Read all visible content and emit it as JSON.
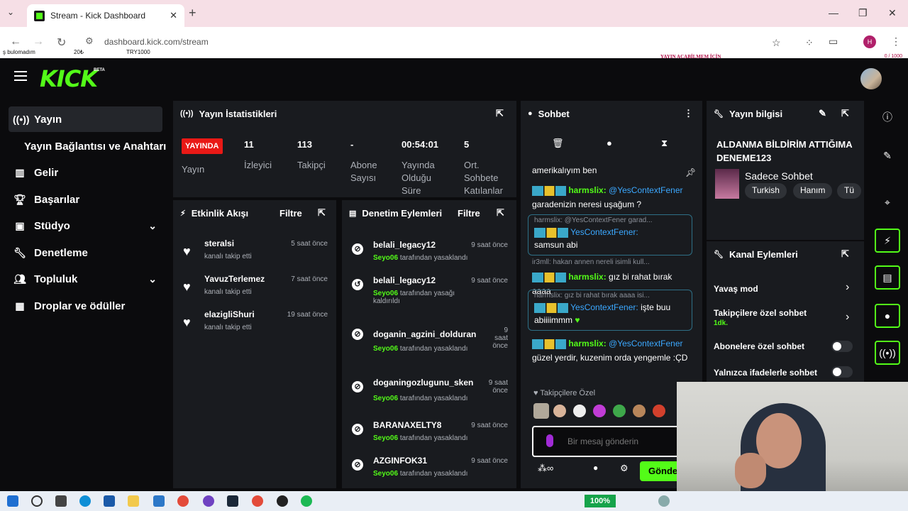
{
  "browser": {
    "tab_title": "Stream - Kick Dashboard",
    "url": "dashboard.kick.com/stream",
    "overlay_left": [
      "ş bulomadım",
      "20₺",
      "TRY1000"
    ],
    "overlay_right_title": "YAYIN AÇABİLMEM İÇİN",
    "overlay_right_count": "0 / 1000"
  },
  "header": {
    "logo": "KICK",
    "beta": "BETA"
  },
  "sidebar": {
    "items": [
      {
        "label": "Yayın",
        "icon": "broadcast-icon"
      },
      {
        "label": "Yayın Bağlantısı ve Anahtarı",
        "icon": ""
      },
      {
        "label": "Gelir",
        "icon": "bar-chart-icon"
      },
      {
        "label": "Başarılar",
        "icon": "trophy-icon"
      },
      {
        "label": "Stüdyo",
        "icon": "studio-icon"
      },
      {
        "label": "Denetleme",
        "icon": "wrench-icon"
      },
      {
        "label": "Topluluk",
        "icon": "users-icon"
      },
      {
        "label": "Droplar ve ödüller",
        "icon": "gift-icon"
      }
    ]
  },
  "stats": {
    "title": "Yayın İstatistikleri",
    "live_badge": "YAYINDA",
    "label_stream": "Yayın",
    "values": [
      "11",
      "113",
      "-",
      "00:54:01",
      "5"
    ],
    "labels": [
      "İzleyici",
      "Takipçi",
      "Abone\nSayısı",
      "Yayında\nOlduğu\nSüre",
      "Ort.\nSohbete\nKatılanlar"
    ]
  },
  "activity": {
    "title": "Etkinlik Akışı",
    "filter": "Filtre",
    "items": [
      {
        "name": "steralsi",
        "sub": "kanalı takip etti",
        "time": "5 saat önce"
      },
      {
        "name": "YavuzTerlemez",
        "sub": "kanalı takip etti",
        "time": "7 saat önce"
      },
      {
        "name": "elazigliShuri",
        "sub": "kanalı takip etti",
        "time": "19 saat önce"
      }
    ]
  },
  "moderation": {
    "title": "Denetim Eylemleri",
    "filter": "Filtre",
    "items": [
      {
        "name": "belali_legacy12",
        "mod": "Seyo06",
        "sub": "tarafından yasaklandı",
        "time": "9 saat önce"
      },
      {
        "name": "belali_legacy12",
        "mod": "Seyo06",
        "sub": "tarafından yasağı kaldırıldı",
        "time": "9 saat önce"
      },
      {
        "name": "doganin_agzini_dolduran",
        "mod": "Seyo06",
        "sub": "tarafından yasaklandı",
        "time": "9 saat önce"
      },
      {
        "name": "doganingozlugunu_sken",
        "mod": "Seyo06",
        "sub": "tarafından yasaklandı",
        "time": "9 saat önce"
      },
      {
        "name": "BARANAXELTY8",
        "mod": "Seyo06",
        "sub": "tarafından yasaklandı",
        "time": "9 saat önce"
      },
      {
        "name": "AZGINFOK31",
        "mod": "Seyo06",
        "sub": "tarafından yasaklandı",
        "time": "9 saat önce"
      }
    ]
  },
  "chat": {
    "title": "Sohbet",
    "messages": {
      "m0": "amerikalıyım ben",
      "m1_user": "harmslix:",
      "m1_mention": "@YesContextFener",
      "m1_text": "garadenizin neresi uşağum ?",
      "m2_quote": "harmslix: @YesContextFener garad...",
      "m2_user": "YesContextFener:",
      "m2_text": "samsun abi",
      "m3_quote": "ir3mll: hakan annen nereli isimli kull...",
      "m3_user": "harmslix:",
      "m3_text": "gız bi rahat bırak aaaa",
      "m4_quote": "harmslix: gız bi rahat bırak aaaa isi...",
      "m4_user": "YesContextFener:",
      "m4_text": "işte buu abiiiimmm",
      "m5_user": "harmslix:",
      "m5_mention": "@YesContextFener",
      "m5_text": "güzel yerdir, kuzenim orda yengemle :ÇD"
    },
    "followers_only": "Takipçilere Özel",
    "placeholder": "Bir mesaj gönderin",
    "send": "Gönde"
  },
  "stream_info": {
    "title": "Yayın bilgisi",
    "stream_title": "ALDANMA BİLDİRİM ATTIĞIMA DENEME123",
    "category": "Sadece Sohbet",
    "tags": [
      "Turkish",
      "Hanım",
      "Tü"
    ]
  },
  "channel_actions": {
    "title": "Kanal Eylemleri",
    "slow_mode": "Yavaş mod",
    "followers_chat": "Takipçilere özel sohbet",
    "followers_chat_value": "1dk.",
    "subs_chat": "Abonelere özel sohbet",
    "emote_chat": "Yalnızca ifadelerle sohbet"
  },
  "taskbar": {
    "battery": "100%"
  }
}
